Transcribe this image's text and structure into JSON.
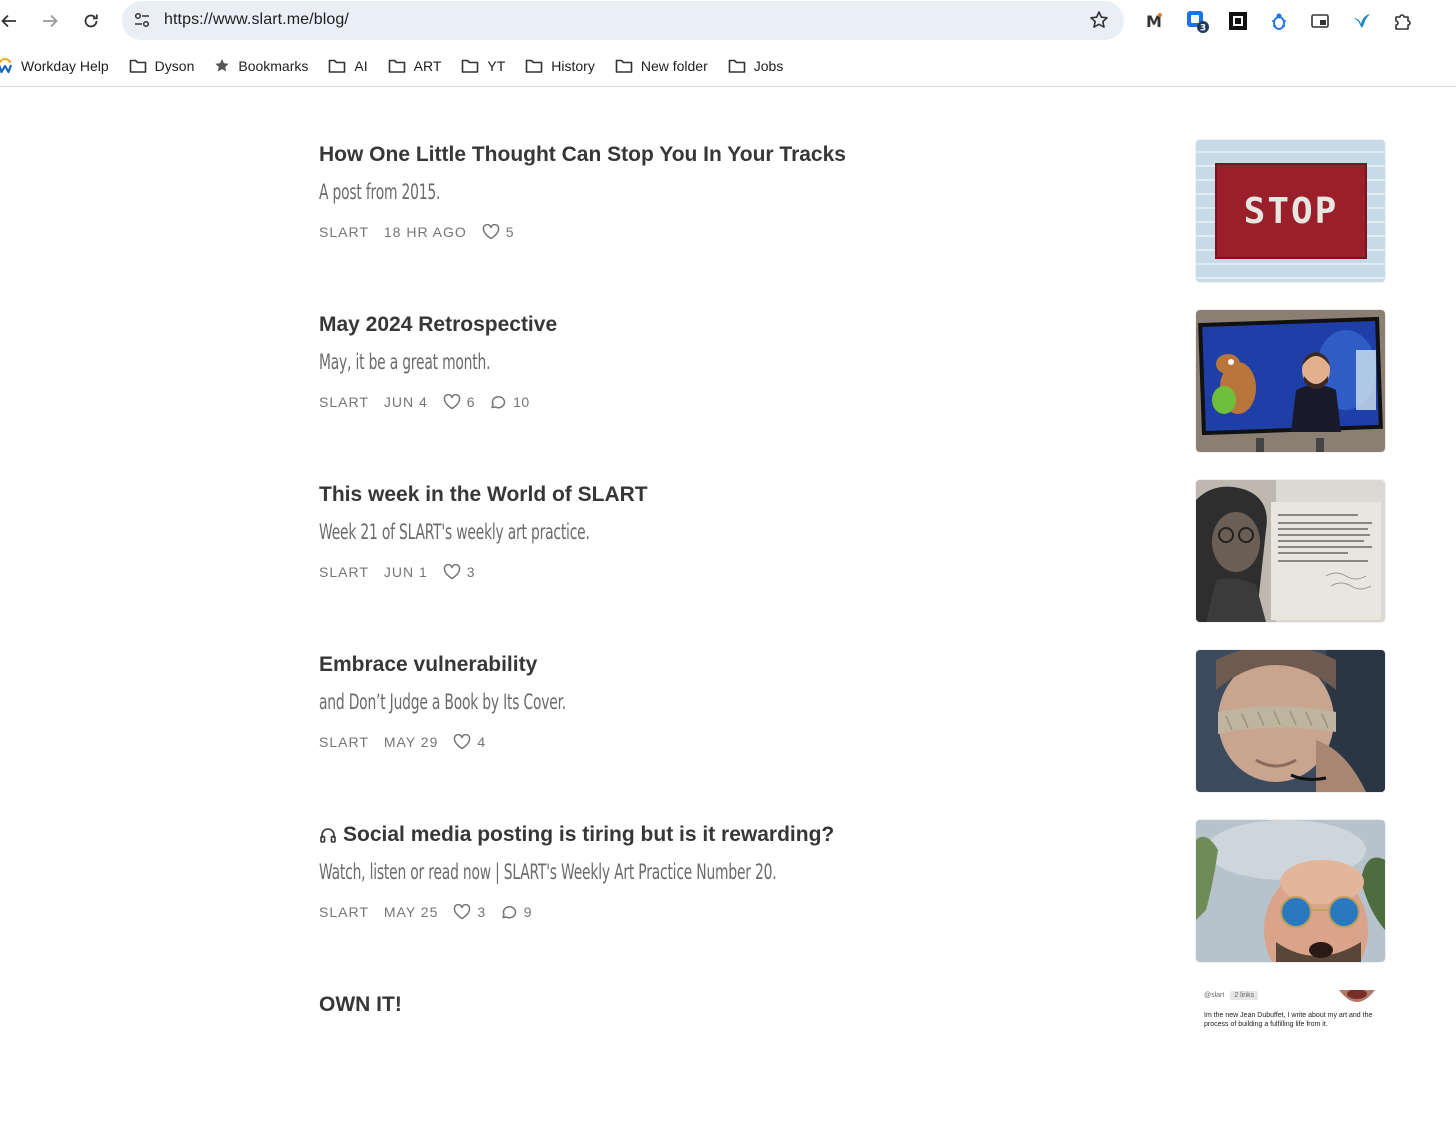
{
  "browser": {
    "url": "https://www.slart.me/blog/",
    "extension_badge": "3"
  },
  "bookmarks": [
    {
      "label": "Workday Help",
      "icon": "workday-icon"
    },
    {
      "label": "Dyson",
      "icon": "folder-icon"
    },
    {
      "label": "Bookmarks",
      "icon": "star-icon"
    },
    {
      "label": "AI",
      "icon": "folder-icon"
    },
    {
      "label": "ART",
      "icon": "folder-icon"
    },
    {
      "label": "YT",
      "icon": "folder-icon"
    },
    {
      "label": "History",
      "icon": "folder-icon"
    },
    {
      "label": "New folder",
      "icon": "folder-icon"
    },
    {
      "label": "Jobs",
      "icon": "folder-icon"
    }
  ],
  "posts": [
    {
      "title": "How One Little Thought Can Stop You In Your Tracks",
      "subtitle": "A post from 2015.",
      "author": "SLART",
      "date": "18 HR AGO",
      "likes": "5",
      "comments": "",
      "thumb_text": "STOP"
    },
    {
      "title": "May 2024 Retrospective",
      "subtitle": "May, it be a great month.",
      "author": "SLART",
      "date": "JUN 4",
      "likes": "6",
      "comments": "10"
    },
    {
      "title": "This week in the World of SLART",
      "subtitle": "Week 21 of SLART's weekly art practice.",
      "author": "SLART",
      "date": "JUN 1",
      "likes": "3",
      "comments": ""
    },
    {
      "title": "Embrace vulnerability",
      "subtitle": "and Don’t Judge a Book by Its Cover.",
      "author": "SLART",
      "date": "MAY 29",
      "likes": "4",
      "comments": ""
    },
    {
      "title": "Social media posting is tiring but is it rewarding?",
      "subtitle": "Watch, listen or read now | SLART's Weekly Art Practice Number 20.",
      "author": "SLART",
      "date": "MAY 25",
      "likes": "3",
      "comments": "9",
      "has_audio": true
    },
    {
      "title": "OWN IT!",
      "thumb_handle": "@slart",
      "thumb_badge": "2 links",
      "thumb_text": "Im the new Jean Dubuffet, I write about my art and the process of building a fulfilling life from it."
    }
  ],
  "colors": {
    "title": "#363737",
    "subtitle": "#6b6b6b",
    "meta": "#757575",
    "omnibox": "#eaeef5"
  }
}
